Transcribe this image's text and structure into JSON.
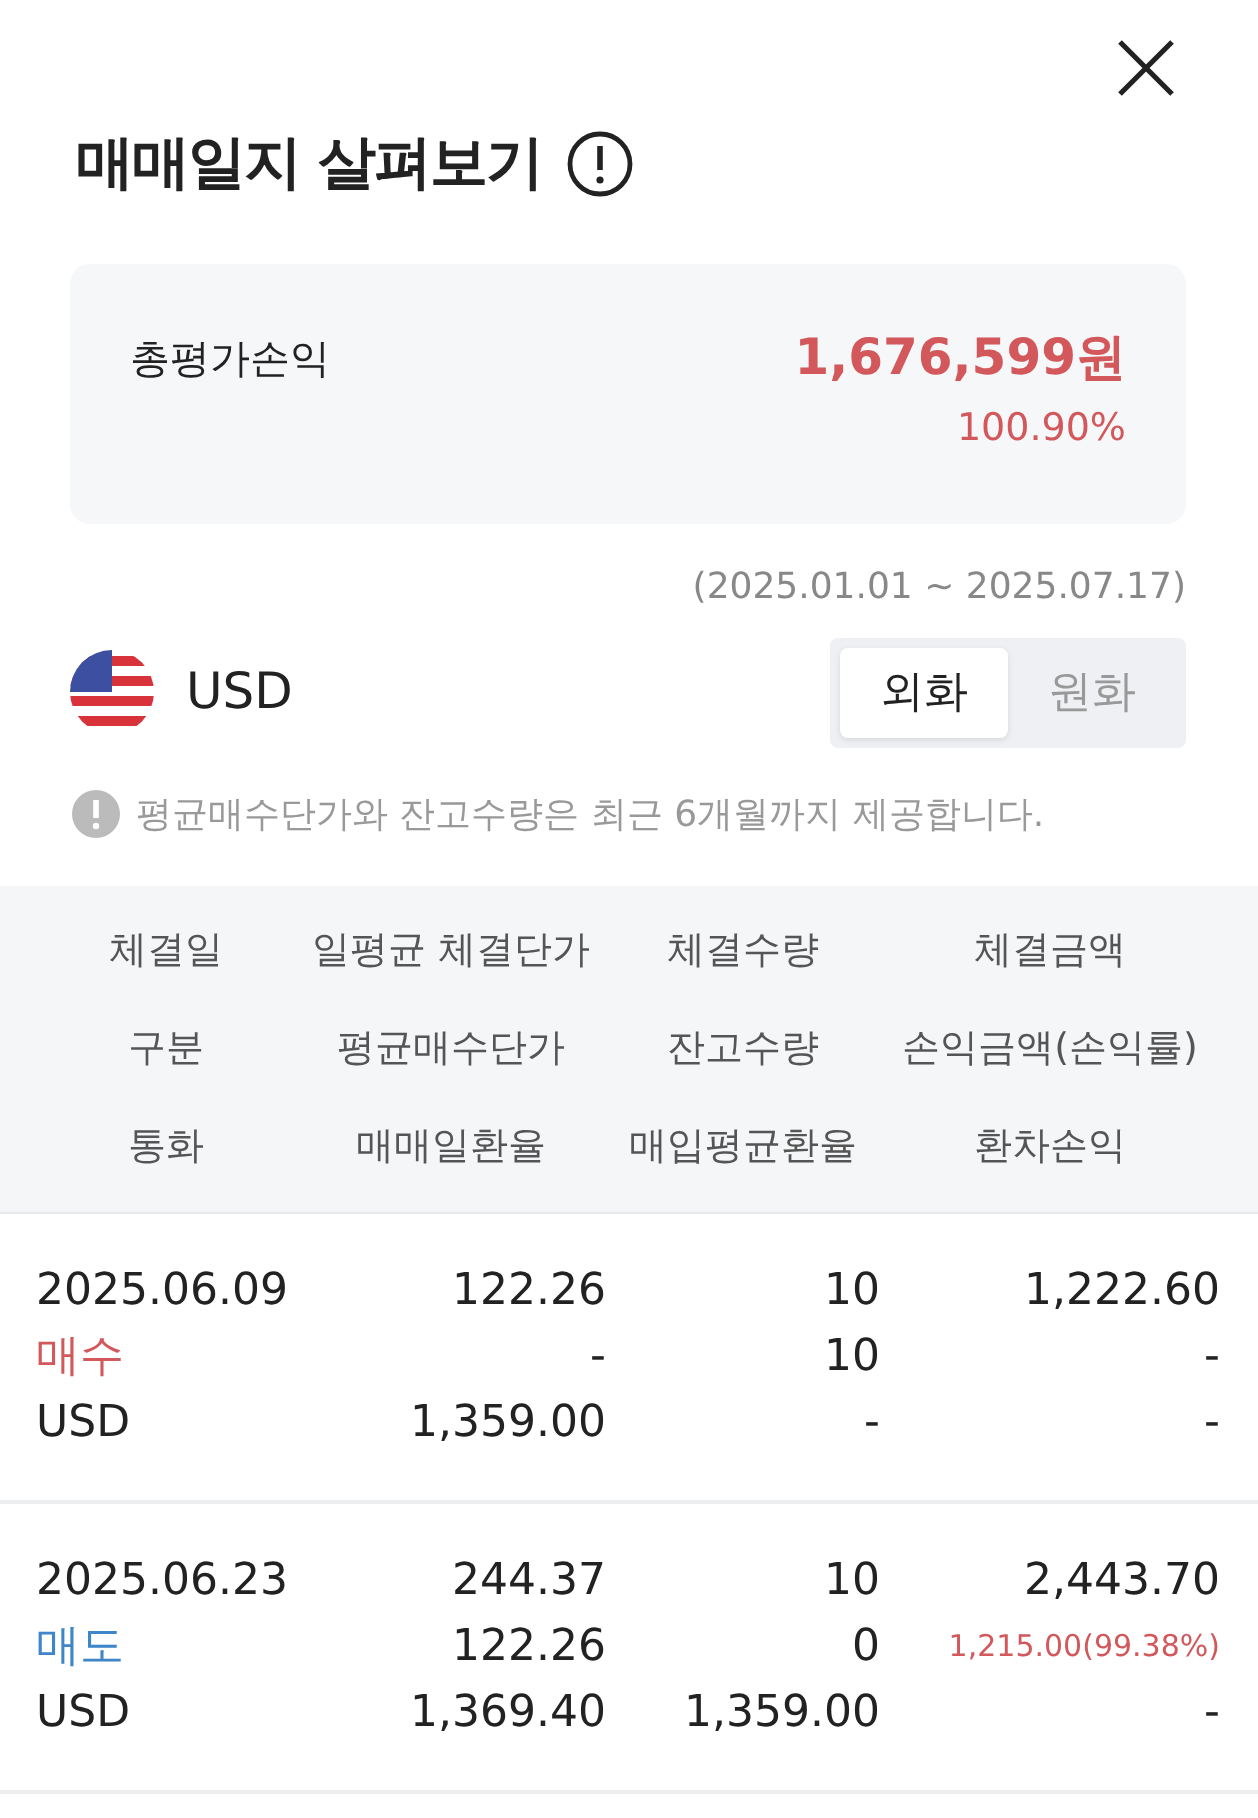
{
  "title": "매매일지 살펴보기",
  "summary": {
    "label": "총평가손익",
    "amount": "1,676,599원",
    "rate": "100.90%",
    "color": "#d2585c"
  },
  "period": "(2025.01.01 ~ 2025.07.17)",
  "currency": "USD",
  "toggle": [
    {
      "label": "외화",
      "selected": true
    },
    {
      "label": "원화",
      "selected": false
    }
  ],
  "notice": "평균매수단가와 잔고수량은 최근 6개월까지 제공합니다.",
  "columns": [
    [
      "체결일",
      "일평균 체결단가",
      "체결수량",
      "체결금액"
    ],
    [
      "구분",
      "평균매수단가",
      "잔고수량",
      "손익금액(손익률)"
    ],
    [
      "통화",
      "매매일환율",
      "매입평균환율",
      "환차손익"
    ]
  ],
  "rows": [
    {
      "lines": [
        [
          {
            "text": "2025.06.09"
          },
          {
            "text": "122.26"
          },
          {
            "text": "10"
          },
          {
            "text": "1,222.60"
          }
        ],
        [
          {
            "text": "매수",
            "color": "#d2585c"
          },
          {
            "text": "-"
          },
          {
            "text": "10"
          },
          {
            "text": "-"
          }
        ],
        [
          {
            "text": "USD"
          },
          {
            "text": "1,359.00"
          },
          {
            "text": "-"
          },
          {
            "text": "-"
          }
        ]
      ]
    },
    {
      "lines": [
        [
          {
            "text": "2025.06.23"
          },
          {
            "text": "244.37"
          },
          {
            "text": "10"
          },
          {
            "text": "2,443.70"
          }
        ],
        [
          {
            "text": "매도",
            "color": "#3f86c9"
          },
          {
            "text": "122.26"
          },
          {
            "text": "0"
          },
          {
            "text": "1,215.00(99.38%)",
            "color": "#d2585c",
            "small": true
          }
        ],
        [
          {
            "text": "USD"
          },
          {
            "text": "1,369.40"
          },
          {
            "text": "1,359.00"
          },
          {
            "text": "-"
          }
        ]
      ]
    }
  ]
}
